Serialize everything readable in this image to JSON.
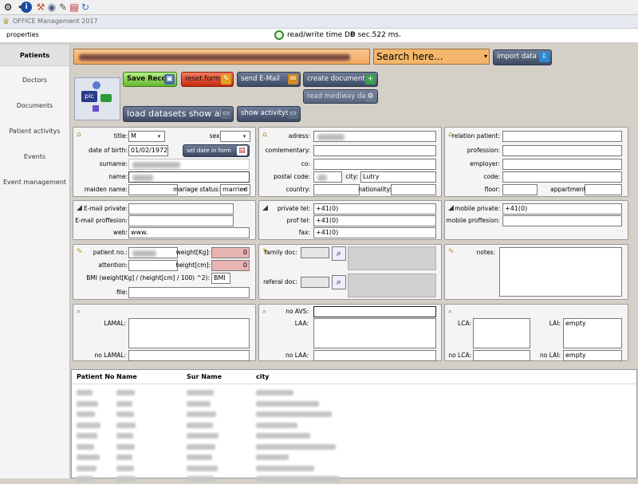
{
  "app": {
    "title": "OFFICE Management 2017"
  },
  "menu": {
    "properties": "properties"
  },
  "status": {
    "label": "read/write time DB",
    "time": "0 sec.522 ms."
  },
  "nav": [
    {
      "label": "Patients",
      "active": true
    },
    {
      "label": "Doctors",
      "active": false
    },
    {
      "label": "Documents",
      "active": false
    },
    {
      "label": "Patient activitys",
      "active": false
    },
    {
      "label": "Events",
      "active": false
    },
    {
      "label": "Event management",
      "active": false
    }
  ],
  "search": {
    "placeholder": "Search here..."
  },
  "buttons": {
    "import": "import data",
    "save": "Save Record",
    "reset": "reset form",
    "email": "send E-Mail",
    "create_doc": "create document",
    "read_mediway": "read mediway data",
    "load_all": "load datasets show all",
    "show_activity": "show activitys",
    "set_date": "set date in form",
    "pic": "pic"
  },
  "patient": {
    "title_label": "title:",
    "title_value": "M",
    "sex_label": "sex:",
    "sex_value": "",
    "dob_label": "date of birth:",
    "dob_value": "01/02/1972",
    "surname_label": "surname:",
    "name_label": "name:",
    "maiden_label": "maiden name:",
    "marriage_label": "mariage status:",
    "marriage_value": "married"
  },
  "address": {
    "adress_label": "adress:",
    "comlementary_label": "comlementary:",
    "co_label": "co:",
    "postal_label": "postal code:",
    "city_label": "city:",
    "city_value": "Lutry",
    "country_label": "country:",
    "nationality_label": "nationality:"
  },
  "relation": {
    "relation_label": "relation patient:",
    "profession_label": "profession:",
    "employer_label": "employer:",
    "code_label": "code:",
    "floor_label": "floor:",
    "appartment_label": "appartment:"
  },
  "contact": {
    "email_private_label": "E-mail private:",
    "email_prof_label": "E-mail proffesion:",
    "web_label": "web:",
    "web_value": "www."
  },
  "phones": {
    "private_tel_label": "private tel:",
    "private_tel_value": "+41(0)",
    "prof_tel_label": "prof tel:",
    "prof_tel_value": "+41(0)",
    "fax_label": "fax:",
    "fax_value": "+41(0)"
  },
  "mobile": {
    "mobile_private_label": "mobile private:",
    "mobile_private_value": "+41(0)",
    "mobile_prof_label": "mobile proffesion:"
  },
  "medical": {
    "patient_no_label": "patient no.:",
    "weight_label": "weight[Kg]:",
    "weight_value": "0",
    "attention_label": "attention:",
    "height_label": "height[cm]:",
    "height_value": "0",
    "bmi_label": "BMI (weight[Kg] / (height[cm] / 100) ^2):",
    "bmi_value": "BMI",
    "file_label": "file:"
  },
  "doctors": {
    "family_label": "family doc:",
    "referal_label": "referal doc:"
  },
  "notes": {
    "label": "notes:"
  },
  "insurance": {
    "lamal_label": "LAMAL:",
    "no_lamal_label": "no LAMAL:",
    "no_avs_label": "no AVS:",
    "laa_label": "LAA:",
    "no_laa_label": "no LAA:",
    "lca_label": "LCA:",
    "no_lca_label": "no LCA:",
    "lai_label": "LAI:",
    "lai_value": "empty",
    "no_lai_label": "no LAI:",
    "no_lai_value": "empty"
  },
  "grid": {
    "columns": [
      "Patient No",
      "Name",
      "Sur Name",
      "city"
    ],
    "row_count": 9
  },
  "colors": {
    "accent": "#3e4a63",
    "search_bg": "#f4b66a",
    "highlight": "#e8b4b4"
  }
}
